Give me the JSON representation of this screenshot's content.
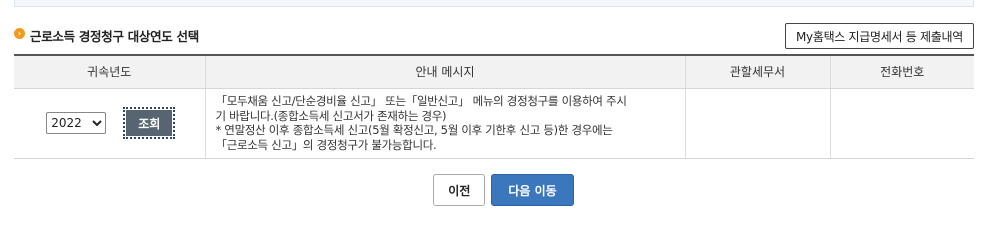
{
  "section": {
    "bullet_icon": "circle-chevron-right-icon",
    "title": "근로소득 경정청구 대상연도 선택",
    "hometax_button_label": "My홈택스 지급명세서 등 제출내역"
  },
  "table": {
    "columns": [
      "귀속년도",
      "안내 메시지",
      "관할세무서",
      "전화번호"
    ],
    "row": {
      "year_selected": "2022",
      "query_label": "조회",
      "message_lines": [
        "「모두채움 신고/단순경비율 신고」 또는「일반신고」 메뉴의 경정청구를 이용하여 주시",
        "기 바랍니다.(종합소득세 신고서가 존재하는 경우)",
        "* 연말정산 이후 종합소득세 신고(5월 확정신고, 5월 이후 기한후 신고 등)한 경우에는",
        "「근로소득 신고」의 경정청구가 불가능합니다."
      ],
      "tax_office": "",
      "phone": ""
    }
  },
  "footer": {
    "prev_label": "이전",
    "next_label": "다음 이동"
  },
  "colors": {
    "accent_orange": "#f39a1e",
    "query_button": "#566571",
    "primary_button": "#3a77bd"
  }
}
